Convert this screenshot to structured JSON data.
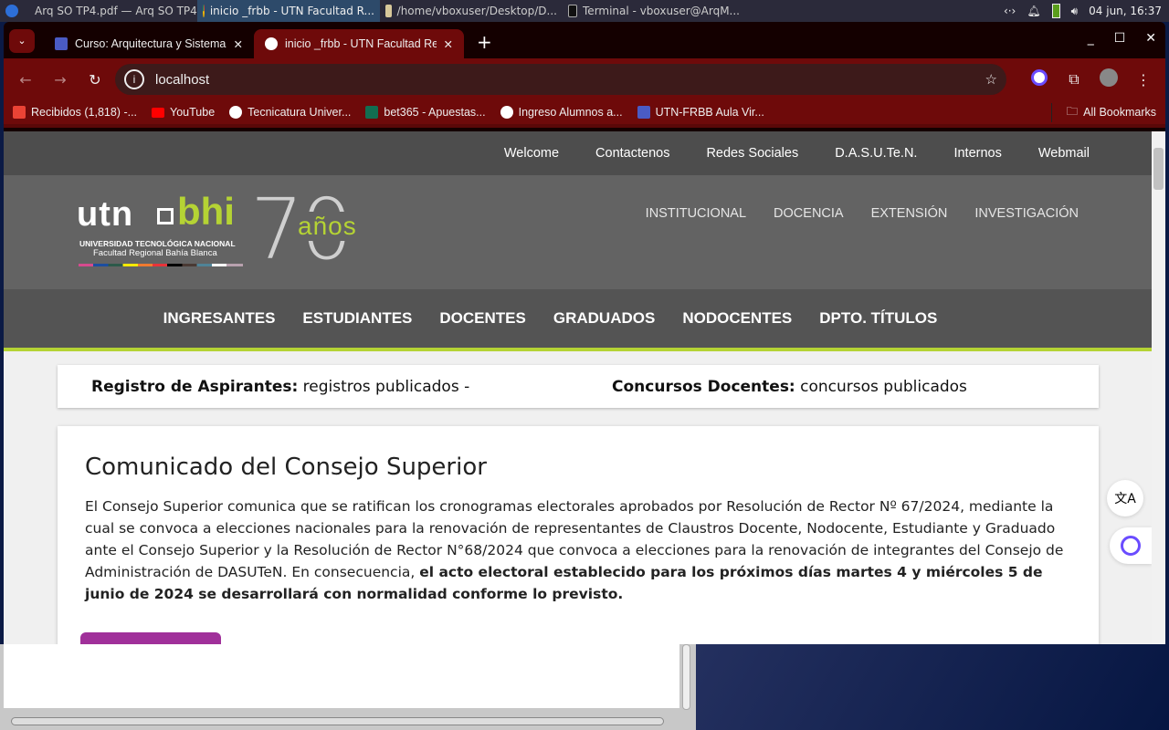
{
  "taskbar": {
    "items": [
      {
        "label": "Arq SO TP4.pdf — Arq SO TP4"
      },
      {
        "label": "inicio _frbb - UTN Facultad R..."
      },
      {
        "label": "/home/vboxuser/Desktop/D..."
      },
      {
        "label": "Terminal - vboxuser@ArqM..."
      }
    ],
    "clock": "04 jun, 16:37"
  },
  "tabs": [
    {
      "label": "Curso: Arquitectura y Sistema"
    },
    {
      "label": "inicio _frbb - UTN Facultad Reg"
    }
  ],
  "address": "localhost",
  "bookmarks": [
    {
      "label": "Recibidos (1,818) -..."
    },
    {
      "label": "YouTube"
    },
    {
      "label": "Tecnicatura Univer..."
    },
    {
      "label": "bet365 - Apuestas..."
    },
    {
      "label": "Ingreso Alumnos a..."
    },
    {
      "label": "UTN-FRBB Aula Vir..."
    }
  ],
  "all_bookmarks": "All Bookmarks",
  "site": {
    "topnav": [
      "Welcome",
      "Contactenos",
      "Redes Sociales",
      "D.A.S.U.Te.N.",
      "Internos",
      "Webmail"
    ],
    "logo": {
      "utn": "utn",
      "bhi": "bhi",
      "line1": "UNIVERSIDAD TECNOLÓGICA NACIONAL",
      "line2": "Facultad Regional Bahía Blanca",
      "anos": "años",
      "seventy": "70"
    },
    "inst_nav": [
      "INSTITUCIONAL",
      "DOCENCIA",
      "EXTENSIÓN",
      "INVESTIGACIÓN"
    ],
    "menu": [
      "INGRESANTES",
      "ESTUDIANTES",
      "DOCENTES",
      "GRADUADOS",
      "NODOCENTES",
      "DPTO. TÍTULOS"
    ],
    "notice": {
      "a_bold": "Registro de Aspirantes:",
      "a_text": " registros publicados -",
      "b_bold": "Concursos Docentes:",
      "b_text": " concursos publicados"
    },
    "card": {
      "title": "Comunicado del Consejo Superior",
      "body": "El Consejo Superior comunica que se ratifican los cronogramas electorales aprobados por Resolución de Rector Nº 67/2024, mediante la cual se convoca a elecciones nacionales para la renovación de representantes de Claustros Docente, Nodocente, Estudiante y Graduado ante el Consejo Superior y la Resolución de Rector N°68/2024 que convoca a elecciones para la renovación de integrantes del Consejo de Administración de DASUTeN. En consecuencia, ",
      "bold": "el acto electoral establecido para los próximos días martes 4 y miércoles 5 de junio de 2024 se desarrollará con normalidad conforme lo previsto."
    }
  },
  "colors": {
    "accent_green": "#b5d334",
    "browser_red": "#6e0a0a",
    "button_purple": "#a0309a"
  }
}
